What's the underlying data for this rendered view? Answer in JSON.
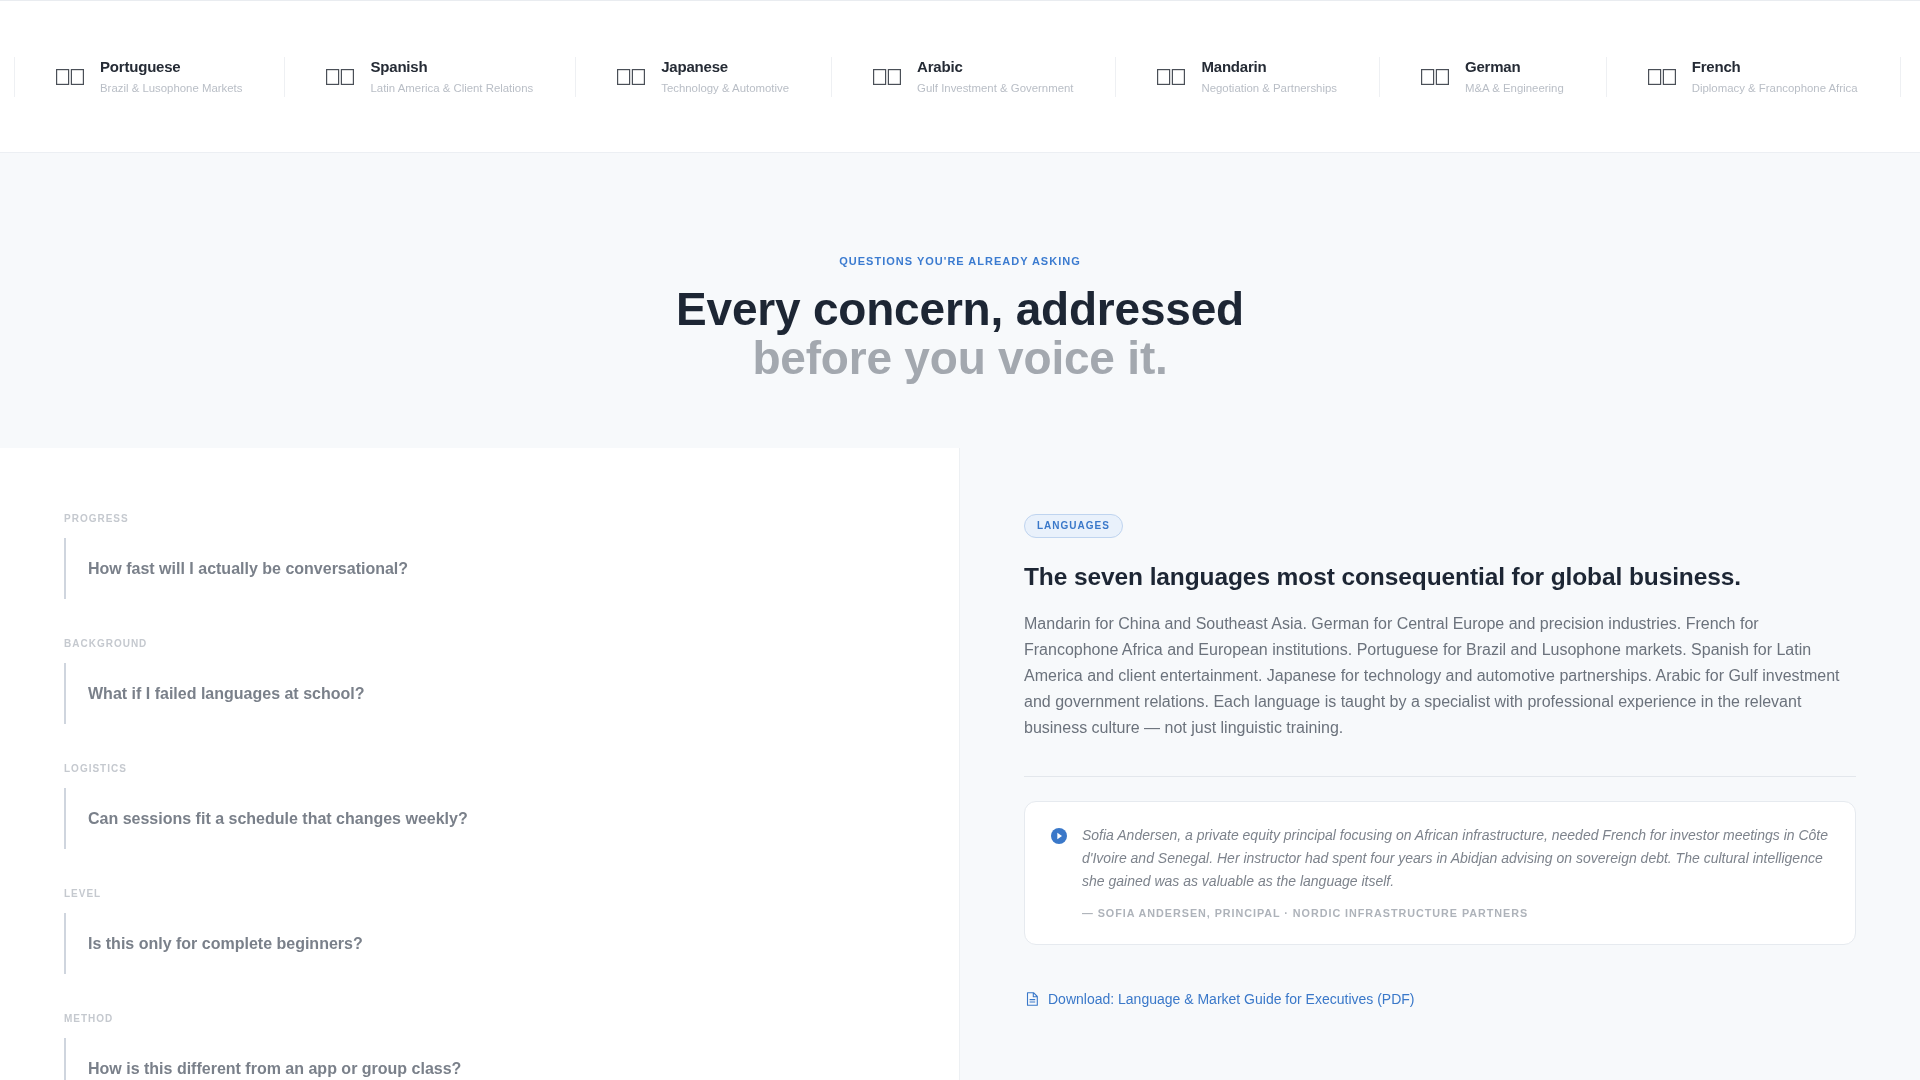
{
  "language_strip": [
    {
      "name": "Portuguese",
      "description": "Brazil & Lusophone Markets"
    },
    {
      "name": "Spanish",
      "description": "Latin America & Client Relations"
    },
    {
      "name": "Japanese",
      "description": "Technology & Automotive"
    },
    {
      "name": "Arabic",
      "description": "Gulf Investment & Government"
    },
    {
      "name": "Mandarin",
      "description": "Negotiation & Partnerships"
    },
    {
      "name": "German",
      "description": "M&A & Engineering"
    },
    {
      "name": "French",
      "description": "Diplomacy & Francophone Africa"
    }
  ],
  "faq_header": {
    "eyebrow": "QUESTIONS YOU'RE ALREADY ASKING",
    "title": "Every concern, addressed",
    "title_muted": "before you voice it."
  },
  "questions": [
    {
      "category": "PROGRESS",
      "question": "How fast will I actually be conversational?",
      "selected": false
    },
    {
      "category": "BACKGROUND",
      "question": "What if I failed languages at school?",
      "selected": false
    },
    {
      "category": "LOGISTICS",
      "question": "Can sessions fit a schedule that changes weekly?",
      "selected": false
    },
    {
      "category": "LEVEL",
      "question": "Is this only for complete beginners?",
      "selected": false
    },
    {
      "category": "METHOD",
      "question": "How is this different from an app or group class?",
      "selected": false
    }
  ],
  "answer": {
    "tag": "LANGUAGES",
    "heading": "The seven languages most consequential for global business.",
    "body": "Mandarin for China and Southeast Asia. German for Central Europe and precision industries. French for Francophone Africa and European institutions. Portuguese for Brazil and Lusophone markets. Spanish for Latin America and client entertainment. Japanese for technology and automotive partnerships. Arabic for Gulf investment and government relations. Each language is taught by a specialist with professional experience in the relevant business culture — not just linguistic training.",
    "testimonial": {
      "quote": "Sofia Andersen, a private equity principal focusing on African infrastructure, needed French for investor meetings in Côte d'Ivoire and Senegal. Her instructor had spent four years in Abidjan advising on sovereign debt. The cultural intelligence she gained was as valuable as the language itself.",
      "attribution": "— SOFIA ANDERSEN, PRINCIPAL · NORDIC INFRASTRUCTURE PARTNERS"
    },
    "download_link": "Download: Language & Market Guide for Executives (PDF)"
  }
}
